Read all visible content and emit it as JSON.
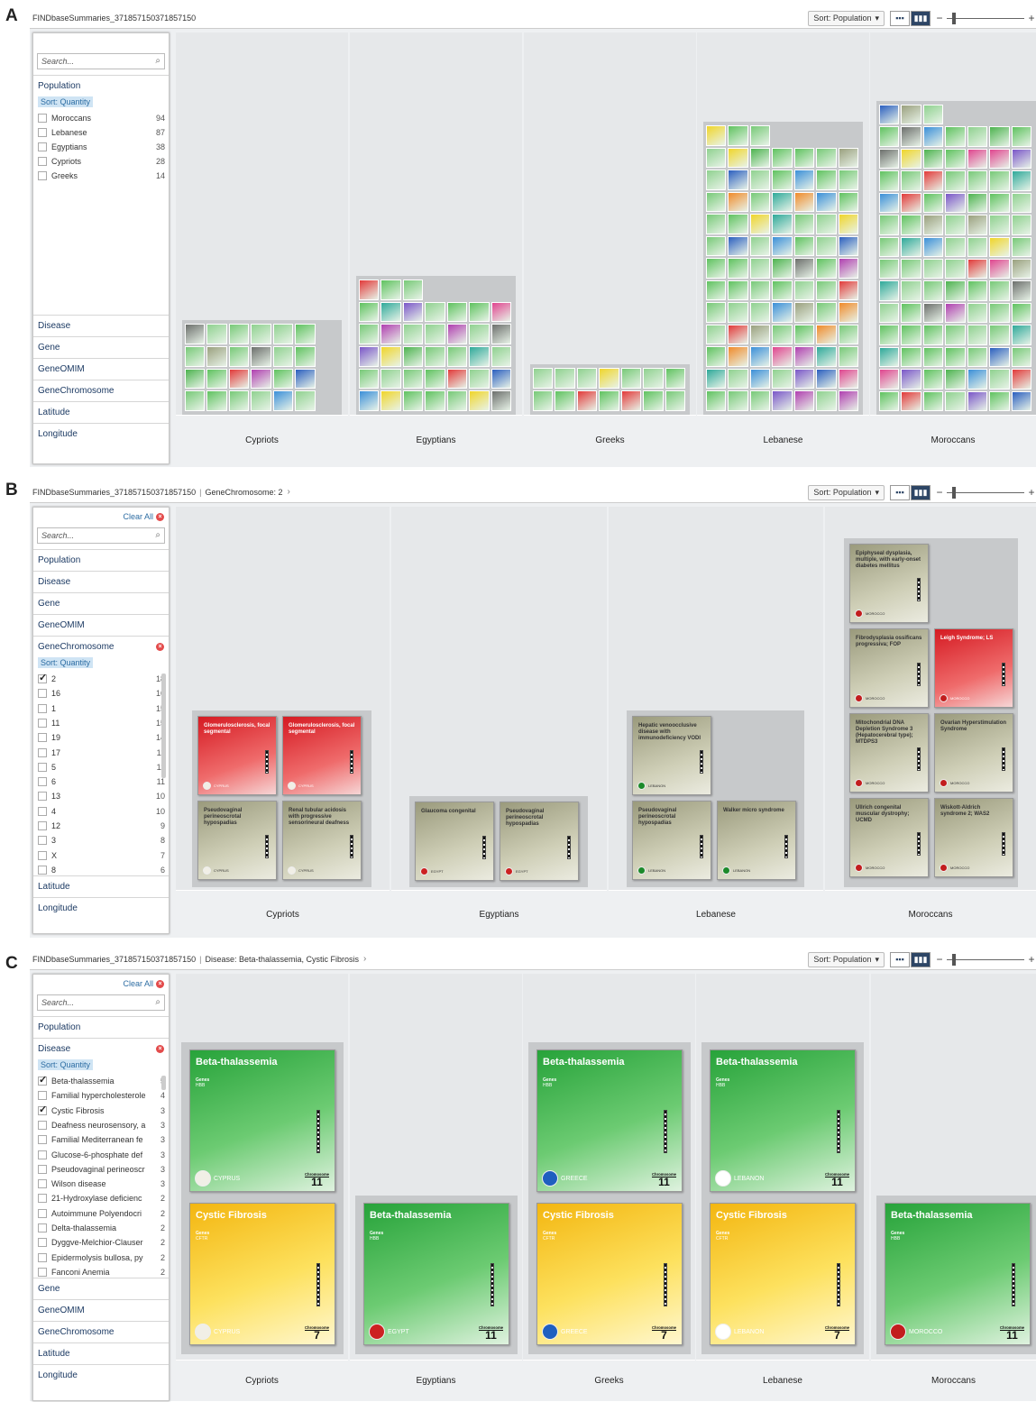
{
  "panel_labels": [
    "A",
    "B",
    "C"
  ],
  "panelA": {
    "breadcrumb": "FINDbaseSummaries_371857150371857150",
    "sort_button": "Sort: Population",
    "search_placeholder": "Search...",
    "facets": [
      {
        "name": "Population",
        "sort_label": "Sort: Quantity",
        "items": [
          {
            "label": "Moroccans",
            "count": "94"
          },
          {
            "label": "Lebanese",
            "count": "87"
          },
          {
            "label": "Egyptians",
            "count": "38"
          },
          {
            "label": "Cypriots",
            "count": "28"
          },
          {
            "label": "Greeks",
            "count": "14"
          }
        ]
      },
      {
        "name": "Disease"
      },
      {
        "name": "Gene"
      },
      {
        "name": "GeneOMIM"
      },
      {
        "name": "GeneChromosome"
      },
      {
        "name": "Latitude"
      },
      {
        "name": "Longitude"
      }
    ],
    "columns": [
      "Cypriots",
      "Egyptians",
      "Greeks",
      "Lebanese",
      "Moroccans"
    ]
  },
  "panelB": {
    "breadcrumb": "FINDbaseSummaries_371857150371857150",
    "filter": "GeneChromosome: 2",
    "sort_button": "Sort: Population",
    "clear_all": "Clear All",
    "search_placeholder": "Search...",
    "facets": [
      "Population",
      "Disease",
      "Gene",
      "GeneOMIM",
      "GeneChromosome",
      "Latitude",
      "Longitude"
    ],
    "sort_label": "Sort: Quantity",
    "chrom_items": [
      {
        "label": "2",
        "count": "18",
        "checked": true
      },
      {
        "label": "16",
        "count": "16"
      },
      {
        "label": "1",
        "count": "15"
      },
      {
        "label": "11",
        "count": "15"
      },
      {
        "label": "19",
        "count": "14"
      },
      {
        "label": "17",
        "count": "11"
      },
      {
        "label": "5",
        "count": "11"
      },
      {
        "label": "6",
        "count": "11"
      },
      {
        "label": "13",
        "count": "10"
      },
      {
        "label": "4",
        "count": "10"
      },
      {
        "label": "12",
        "count": "9"
      },
      {
        "label": "3",
        "count": "8"
      },
      {
        "label": "X",
        "count": "7"
      },
      {
        "label": "8",
        "count": "6"
      }
    ],
    "columns": [
      "Cypriots",
      "Egyptians",
      "Lebanese",
      "Moroccans"
    ],
    "cards": {
      "c1": "Glomerulosclerosis, focal segmental",
      "c2": "Glomerulosclerosis, focal segmental",
      "c3": "Pseudovaginal perineoscrotal hypospadias",
      "c4": "Renal tubular acidosis with progressive sensorineural deafness",
      "e1": "Glaucoma congenital",
      "e2": "Pseudovaginal perineoscrotal hypospadias",
      "l1": "Hepatic venoocclusive disease with immunodeficiency VODI",
      "l2": "Pseudovaginal perineoscrotal hypospadias",
      "l3": "Walker micro syndrome",
      "m1": "Epiphyseal dysplasia, multiple, with early-onset diabetes mellitus",
      "m2": "Fibrodysplasia ossificans progressiva; FOP",
      "m3": "Leigh Syndrome; LS",
      "m4": "Mitochondrial DNA Depletion Syndrome 3 (Hepatocerebral type); MTDPS3",
      "m5": "Ovarian Hyperstimulation Syndrome",
      "m6": "Ullrich congenital muscular dystrophy; UCMD",
      "m7": "Wiskott-Aldrich syndrome 2; WAS2"
    },
    "countries": {
      "cy": "CYPRUS",
      "eg": "EGYPT",
      "lb": "LEBANON",
      "ma": "MOROCCO"
    }
  },
  "panelC": {
    "breadcrumb": "FINDbaseSummaries_371857150371857150",
    "filter": "Disease: Beta-thalassemia, Cystic Fibrosis",
    "sort_button": "Sort: Population",
    "clear_all": "Clear All",
    "search_placeholder": "Search...",
    "facets_top": [
      "Population",
      "Disease"
    ],
    "facets_bottom": [
      "Gene",
      "GeneOMIM",
      "GeneChromosome",
      "Latitude",
      "Longitude"
    ],
    "sort_label": "Sort: Quantity",
    "disease_items": [
      {
        "label": "Beta-thalassemia",
        "count": "5",
        "checked": true
      },
      {
        "label": "Familial hypercholesterole",
        "count": "4"
      },
      {
        "label": "Cystic Fibrosis",
        "count": "3",
        "checked": true
      },
      {
        "label": "Deafness neurosensory, a",
        "count": "3"
      },
      {
        "label": "Familial Mediterranean fe",
        "count": "3"
      },
      {
        "label": "Glucose-6-phosphate def",
        "count": "3"
      },
      {
        "label": "Pseudovaginal perineoscr",
        "count": "3"
      },
      {
        "label": "Wilson disease",
        "count": "3"
      },
      {
        "label": "21-Hydroxylase deficienc",
        "count": "2"
      },
      {
        "label": "Autoimmune Polyendocri",
        "count": "2"
      },
      {
        "label": "Delta-thalassemia",
        "count": "2"
      },
      {
        "label": "Dyggve-Melchior-Clauser",
        "count": "2"
      },
      {
        "label": "Epidermolysis bullosa, py",
        "count": "2"
      },
      {
        "label": "Fanconi Anemia",
        "count": "2"
      }
    ],
    "columns": [
      "Cypriots",
      "Egyptians",
      "Greeks",
      "Lebanese",
      "Moroccans"
    ],
    "card_beta": "Beta-thalassemia",
    "card_cf": "Cystic Fibrosis",
    "genes_label": "Genes",
    "gene_cf": "CFTR",
    "gene_beta": "HBB",
    "chrom_beta": "11",
    "chrom_cf": "7",
    "chrom_label": "Chromosome",
    "countries": {
      "cy": "CYPRUS",
      "eg": "EGYPT",
      "gr": "GREECE",
      "lb": "LEBANON",
      "ma": "MOROCCO"
    }
  },
  "colors": {
    "accent": "#2d6da3",
    "header": "#1c3a63",
    "selected_view": "#2d4565",
    "stack_bg": "#c7c9cb",
    "column_bg": "#e6e8ea"
  }
}
